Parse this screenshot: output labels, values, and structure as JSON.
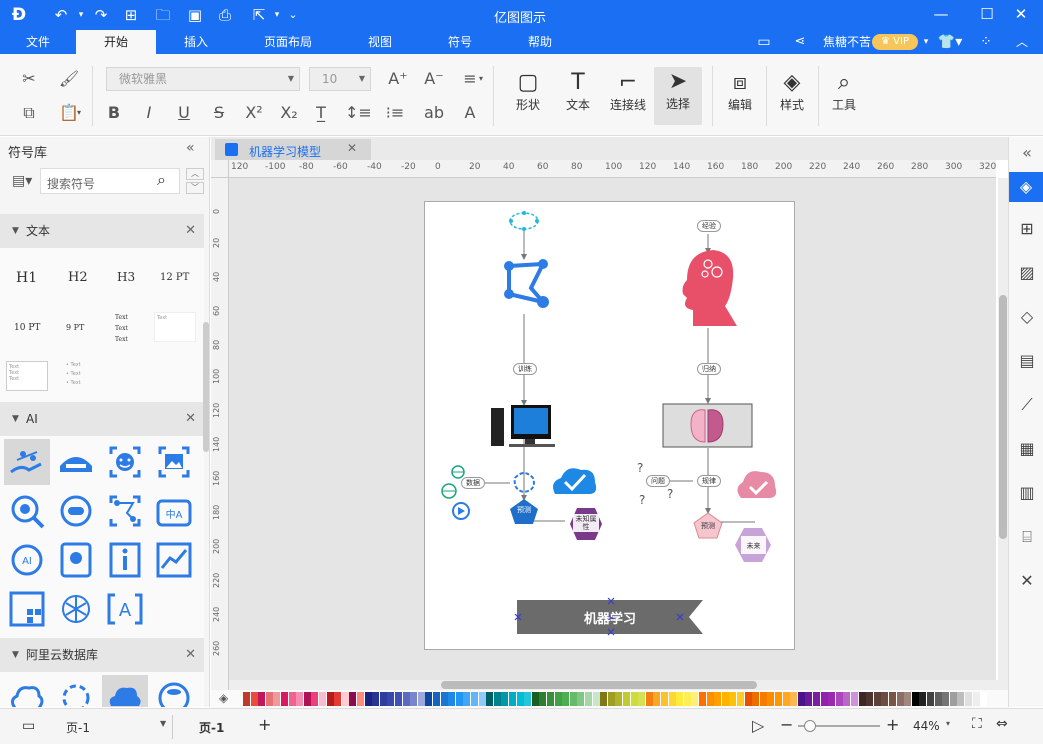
{
  "app": {
    "title": "亿图图示",
    "user": "焦糖不苦",
    "vip": "VIP"
  },
  "menu": {
    "file": "文件",
    "start": "开始",
    "insert": "插入",
    "layout": "页面布局",
    "view": "视图",
    "symbol": "符号",
    "help": "帮助"
  },
  "ribbon": {
    "font_name": "微软雅黑",
    "font_size": "10",
    "shape": "形状",
    "text": "文本",
    "connector": "连接线",
    "select": "选择",
    "edit": "编辑",
    "style": "样式",
    "tools": "工具"
  },
  "sidebar": {
    "title": "符号库",
    "search_placeholder": "搜索符号",
    "sections": {
      "text": "文本",
      "ai": "AI",
      "aliyun": "阿里云数据库"
    },
    "text_items": [
      "H1",
      "H2",
      "H3",
      "12 PT",
      "10 PT",
      "9 PT"
    ],
    "text_small": "Text"
  },
  "tab": {
    "name": "机器学习模型"
  },
  "ruler": {
    "h_ticks": [
      "120",
      "-100",
      "-80",
      "-60",
      "-40",
      "-20",
      "0",
      "20",
      "40",
      "60",
      "80",
      "100",
      "120",
      "140",
      "160",
      "180",
      "200",
      "220",
      "240",
      "260",
      "280",
      "300",
      "320"
    ],
    "v_ticks": [
      "0",
      "20",
      "40",
      "60",
      "80",
      "100",
      "120",
      "140",
      "160",
      "180",
      "200",
      "220",
      "240",
      "260"
    ]
  },
  "diagram": {
    "label_training": "训练",
    "label_data": "数据",
    "label_predict": "预测",
    "label_unknown": "未知属性",
    "label_experience": "经验",
    "label_induction": "归纳",
    "label_question": "问题",
    "label_rule": "规律",
    "label_future": "未来",
    "banner": "机器学习"
  },
  "status": {
    "page_selector": "页-1",
    "page_tab": "页-1",
    "add": "+",
    "zoom": "44%"
  },
  "colors": {
    "accent": "#1b6ff3",
    "icon_blue": "#2d7be5",
    "head_red": "#e8506a",
    "banner": "#6b6b6b"
  },
  "palette": [
    "#c0392b",
    "#e74c3c",
    "#c2185b",
    "#e57373",
    "#ef9a9a",
    "#d81b60",
    "#f06292",
    "#f48fb1",
    "#ad1457",
    "#ec407a",
    "#f8bbd0",
    "#b71c1c",
    "#e53935",
    "#ffcdd2",
    "#880e4f",
    "#ff8a80",
    "#1a237e",
    "#283593",
    "#303f9f",
    "#3949ab",
    "#3f51b5",
    "#5c6bc0",
    "#7986cb",
    "#9fa8da",
    "#0d47a1",
    "#1565c0",
    "#1976d2",
    "#1e88e5",
    "#2196f3",
    "#42a5f5",
    "#64b5f6",
    "#90caf9",
    "#006064",
    "#00838f",
    "#0097a7",
    "#00acc1",
    "#00bcd4",
    "#26c6da",
    "#1b5e20",
    "#2e7d32",
    "#388e3c",
    "#43a047",
    "#4caf50",
    "#66bb6a",
    "#81c784",
    "#a5d6a7",
    "#c8e6c9",
    "#827717",
    "#9e9d24",
    "#afb42b",
    "#c0ca33",
    "#cddc39",
    "#d4e157",
    "#f57f17",
    "#f9a825",
    "#fbc02d",
    "#fdd835",
    "#ffeb3b",
    "#ffee58",
    "#fff176",
    "#ff6f00",
    "#ff8f00",
    "#ffa000",
    "#ffb300",
    "#ffc107",
    "#ffca28",
    "#e65100",
    "#ef6c00",
    "#f57c00",
    "#fb8c00",
    "#ff9800",
    "#ffa726",
    "#ffb74d",
    "#4a148c",
    "#6a1b9a",
    "#7b1fa2",
    "#8e24aa",
    "#9c27b0",
    "#ab47bc",
    "#ba68c8",
    "#ce93d8",
    "#3e2723",
    "#4e342e",
    "#5d4037",
    "#6d4c41",
    "#795548",
    "#8d6e63",
    "#a1887f",
    "#000000",
    "#212121",
    "#424242",
    "#616161",
    "#757575",
    "#9e9e9e",
    "#bdbdbd",
    "#e0e0e0",
    "#eeeeee",
    "#ffffff"
  ]
}
